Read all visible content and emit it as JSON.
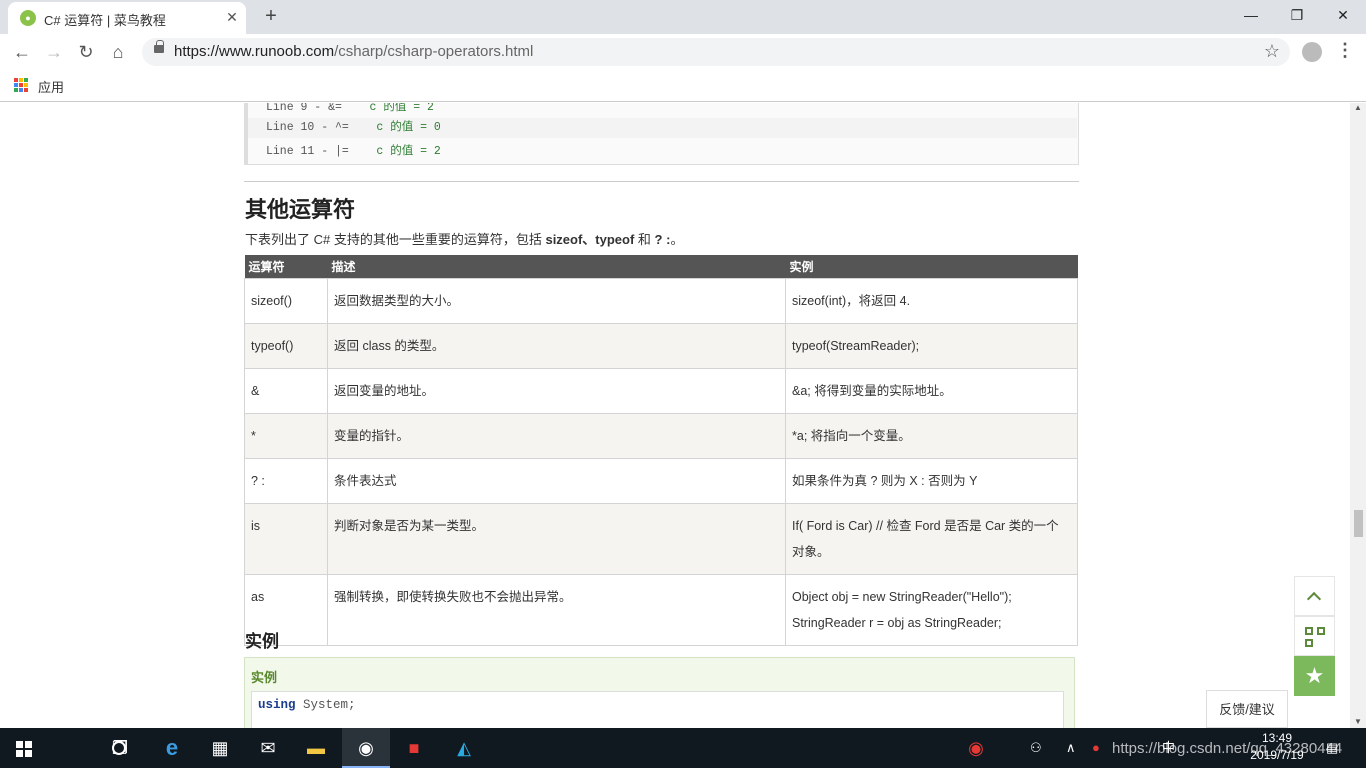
{
  "browser": {
    "tab_title": "C# 运算符 | 菜鸟教程",
    "tab_close": "✕",
    "new_tab": "+",
    "url_host": "https://www.runoob.com",
    "url_path": "/csharp/csharp-operators.html",
    "bookmark_apps_label": "应用",
    "minimize": "—",
    "restore": "❐",
    "close": "✕"
  },
  "code_output": {
    "lines": [
      {
        "prefix": "Line 9 - &=    ",
        "value": "c 的值 = 2"
      },
      {
        "prefix": "Line 10 - ^=    ",
        "value": "c 的值 = 0"
      },
      {
        "prefix": "Line 11 - |=    ",
        "value": "c 的值 = 2"
      }
    ]
  },
  "section": {
    "heading": "其他运算符",
    "intro_prefix": "下表列出了 C# 支持的其他一些重要的运算符，包括 ",
    "intro_bold": "sizeof、typeof",
    "intro_mid": " 和 ",
    "intro_bold2": "? :",
    "intro_suffix": "。"
  },
  "table": {
    "headers": [
      "运算符",
      "描述",
      "实例"
    ],
    "rows": [
      [
        "sizeof()",
        "返回数据类型的大小。",
        "sizeof(int)，将返回 4."
      ],
      [
        "typeof()",
        "返回 class 的类型。",
        "typeof(StreamReader);"
      ],
      [
        "&",
        "返回变量的地址。",
        "&a; 将得到变量的实际地址。"
      ],
      [
        "*",
        "变量的指针。",
        "*a; 将指向一个变量。"
      ],
      [
        "? :",
        "条件表达式",
        "如果条件为真 ? 则为 X : 否则为 Y"
      ],
      [
        "is",
        "判断对象是否为某一类型。",
        "If( Ford is Car) // 检查 Ford 是否是 Car 类的一个对象。"
      ],
      [
        "as",
        "强制转换，即使转换失败也不会抛出异常。",
        "Object obj = new StringReader(\"Hello\");\nStringReader r = obj as StringReader;"
      ]
    ]
  },
  "example": {
    "heading": "实例",
    "box_title": "实例",
    "code_keyword": "using",
    "code_rest": " System;"
  },
  "side": {
    "feedback": "反馈/建议",
    "fav_star": "★"
  },
  "taskbar": {
    "clock_time": "13:49",
    "clock_date": "2019/7/19",
    "overlay": "https://blog.csdn.net/qq_43280444",
    "ime": "中"
  }
}
